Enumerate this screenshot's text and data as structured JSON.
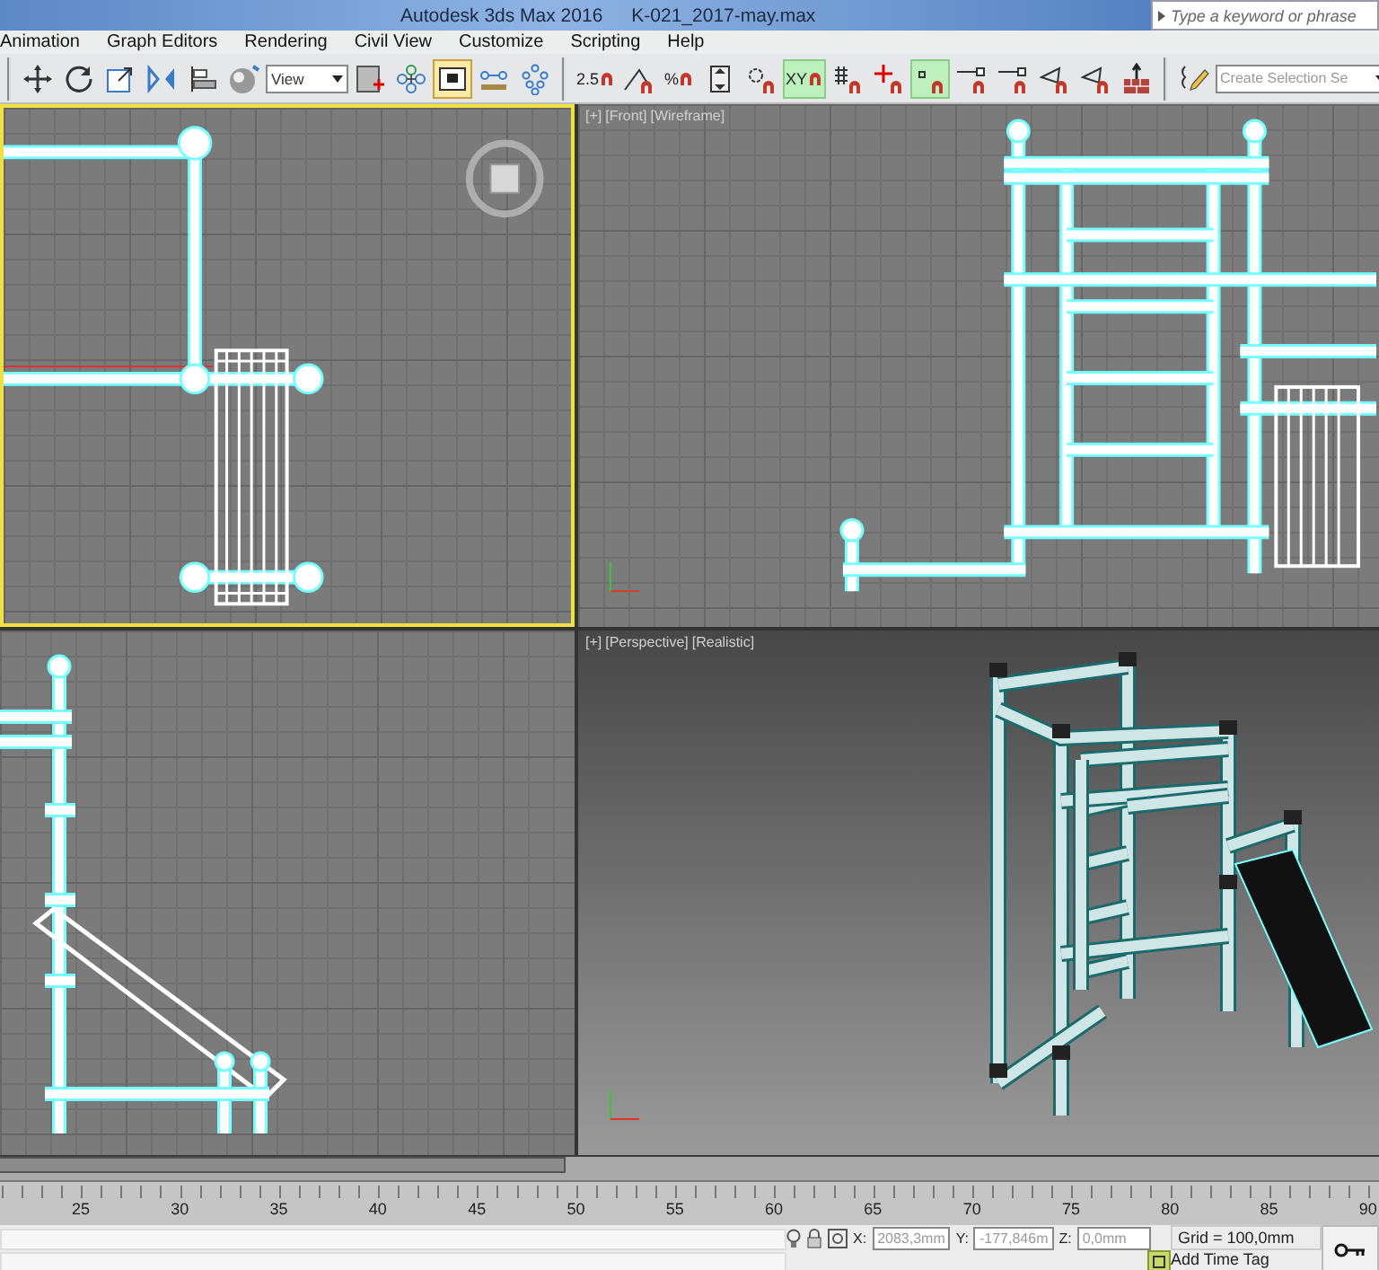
{
  "window": {
    "title": "Autodesk 3ds Max 2016",
    "file": "K-021_2017-may.max"
  },
  "search": {
    "placeholder": "Type a keyword or phrase"
  },
  "menu": [
    "Animation",
    "Graph Editors",
    "Rendering",
    "Civil View",
    "Customize",
    "Scripting",
    "Help"
  ],
  "toolbar": {
    "groups": [
      {
        "tools": [
          {
            "kind": "move",
            "active": false
          },
          {
            "kind": "rotate",
            "active": false
          },
          {
            "kind": "scale",
            "active": false
          },
          {
            "kind": "mirror",
            "active": false
          },
          {
            "kind": "align",
            "active": false
          },
          {
            "kind": "sphere",
            "active": false
          },
          {
            "kind": "dropdown",
            "value": "View"
          },
          {
            "kind": "frame",
            "active": false
          },
          {
            "kind": "pivot",
            "active": false
          },
          {
            "kind": "manipulate",
            "active": true
          },
          {
            "kind": "link",
            "active": false
          },
          {
            "kind": "nodes",
            "active": false
          }
        ]
      },
      {
        "tools": [
          {
            "kind": "snap",
            "label": "2.5",
            "active": false
          },
          {
            "kind": "angle",
            "active": false
          },
          {
            "kind": "snap",
            "label": "%",
            "active": false
          },
          {
            "kind": "spinner",
            "active": false
          },
          {
            "kind": "gear",
            "active": false
          },
          {
            "kind": "snap",
            "label": "XY",
            "active": true
          },
          {
            "kind": "grid",
            "active": false
          },
          {
            "kind": "cross",
            "active": false
          },
          {
            "kind": "point",
            "active": true
          },
          {
            "kind": "edge",
            "active": false
          },
          {
            "kind": "edge",
            "active": false
          },
          {
            "kind": "triangle",
            "active": false
          },
          {
            "kind": "triangle",
            "active": false
          },
          {
            "kind": "brick",
            "active": false
          }
        ]
      },
      {
        "tools": [
          {
            "kind": "pencil",
            "active": false
          },
          {
            "kind": "dropdown",
            "placeholder": "Create Selection Se"
          }
        ]
      }
    ]
  },
  "viewports": [
    {
      "kind": "top",
      "active": true
    },
    {
      "kind": "front",
      "active": false,
      "labels": [
        "[+]",
        "[Front]",
        "[Wireframe]"
      ]
    },
    {
      "kind": "left",
      "active": false
    },
    {
      "kind": "perspective",
      "active": false,
      "labels": [
        "[+]",
        "[Perspective]",
        "[Realistic]"
      ]
    }
  ],
  "timeline": {
    "level": 0.415,
    "ticks": [
      "25",
      "30",
      "35",
      "40",
      "45",
      "50",
      "55",
      "60",
      "65",
      "70",
      "75",
      "80",
      "85",
      "90"
    ]
  },
  "status": {
    "x_label": "X:",
    "y_label": "Y:",
    "z_label": "Z:",
    "x": "2083,3mm",
    "y": "-177,846m",
    "z": "0,0mm",
    "grid": "Grid = 100,0mm",
    "time_tag": "Add Time Tag"
  }
}
